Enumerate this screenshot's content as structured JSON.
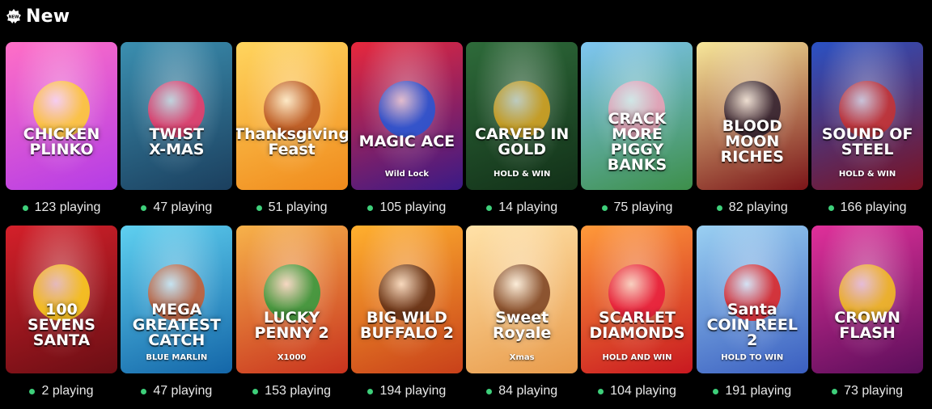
{
  "section": {
    "title": "New",
    "icon": "new-badge-icon"
  },
  "status_color": "#3ecf7a",
  "games": [
    {
      "name": "CHICKEN\nPLINKO",
      "sub": "",
      "players": "123 playing",
      "bg": [
        "#ff6fc6",
        "#b43ce6"
      ],
      "art": "#ffcf2e"
    },
    {
      "name": "TWIST\nX-MAS",
      "sub": "",
      "players": "47 playing",
      "bg": [
        "#3b8fb0",
        "#1b3f5e"
      ],
      "art": "#f03a6a"
    },
    {
      "name": "Thanksgiving\nFeast",
      "sub": "",
      "players": "51 playing",
      "bg": [
        "#ffd55e",
        "#f08a1c"
      ],
      "art": "#b5501e"
    },
    {
      "name": "MAGIC ACE",
      "sub": "Wild Lock",
      "players": "105 playing",
      "bg": [
        "#e8283c",
        "#3a1a86"
      ],
      "art": "#2255d6"
    },
    {
      "name": "CARVED IN\nGOLD",
      "sub": "HOLD & WIN",
      "players": "14 playing",
      "bg": [
        "#2e6b3a",
        "#123018"
      ],
      "art": "#d9a520"
    },
    {
      "name": "CRACK MORE\nPIGGY BANKS",
      "sub": "",
      "players": "75 playing",
      "bg": [
        "#7fc6f2",
        "#3d8f4a"
      ],
      "art": "#f0a0b8"
    },
    {
      "name": "BLOOD MOON\nRICHES",
      "sub": "",
      "players": "82 playing",
      "bg": [
        "#f7e79a",
        "#7a1418"
      ],
      "art": "#2a1a2a"
    },
    {
      "name": "SOUND OF STEEL",
      "sub": "HOLD & WIN",
      "players": "166 playing",
      "bg": [
        "#2a52c4",
        "#7a1222"
      ],
      "art": "#c83030"
    },
    {
      "name": "100\nSEVENS\nSANTA",
      "sub": "",
      "players": "2 playing",
      "bg": [
        "#d4202a",
        "#6a0e14"
      ],
      "art": "#ffd21e"
    },
    {
      "name": "MEGA\nGREATEST\nCATCH",
      "sub": "BLUE MARLIN",
      "players": "47 playing",
      "bg": [
        "#5fd0f0",
        "#1466a8"
      ],
      "art": "#c95a2e"
    },
    {
      "name": "LUCKY\nPENNY 2",
      "sub": "X1000",
      "players": "153 playing",
      "bg": [
        "#f7b24a",
        "#c8321e"
      ],
      "art": "#2e9a3c"
    },
    {
      "name": "BIG WILD\nBUFFALO 2",
      "sub": "",
      "players": "194 playing",
      "bg": [
        "#ffb02e",
        "#c8401a"
      ],
      "art": "#5a2a12"
    },
    {
      "name": "Sweet Royale",
      "sub": "Xmas",
      "players": "84 playing",
      "bg": [
        "#ffe2a8",
        "#e89a4a"
      ],
      "art": "#7a4020"
    },
    {
      "name": "SCARLET\nDIAMONDS",
      "sub": "HOLD AND WIN",
      "players": "104 playing",
      "bg": [
        "#ff9a3a",
        "#c81820"
      ],
      "art": "#e81a3a"
    },
    {
      "name": "Santa\nCOIN REEL 2",
      "sub": "HOLD TO WIN",
      "players": "191 playing",
      "bg": [
        "#9ad0f2",
        "#3a5ec0"
      ],
      "art": "#e02020"
    },
    {
      "name": "CROWN\nFLASH",
      "sub": "",
      "players": "73 playing",
      "bg": [
        "#e0309a",
        "#5a0e5a"
      ],
      "art": "#f5c21e"
    }
  ]
}
